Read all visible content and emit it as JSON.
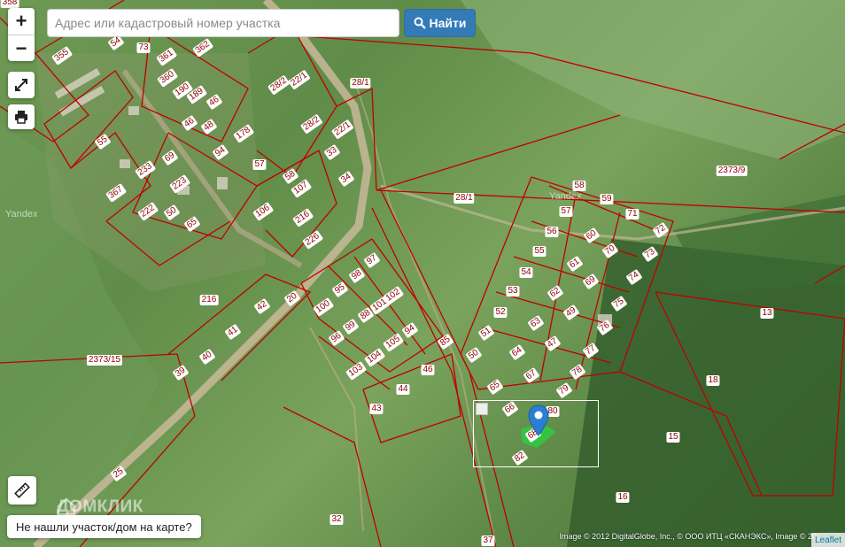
{
  "search": {
    "placeholder": "Адрес или кадастровый номер участка",
    "button_label": "Найти"
  },
  "controls": {
    "zoom_in": "+",
    "zoom_out": "−"
  },
  "help_button": "Не нашли участок/дом на карте?",
  "watermark": "ДОМКЛИК",
  "yandex_labels": [
    "Yandex",
    "Yandex"
  ],
  "attribution": "Image © 2012 DigitalGlobe, Inc., © ООО ИТЦ «СКАНЭКС», Image © 20",
  "leaflet": "Leaflet",
  "colors": {
    "parcel": "#c00000",
    "accent": "#337ab7",
    "marker": "#2a7fd4",
    "highlight": "#2ecc40"
  },
  "parcels": [
    {
      "id": "358"
    },
    {
      "id": "54"
    },
    {
      "id": "73"
    },
    {
      "id": "355"
    },
    {
      "id": "361"
    },
    {
      "id": "362"
    },
    {
      "id": "360"
    },
    {
      "id": "190"
    },
    {
      "id": "189"
    },
    {
      "id": "46"
    },
    {
      "id": "46"
    },
    {
      "id": "48"
    },
    {
      "id": "55"
    },
    {
      "id": "178"
    },
    {
      "id": "69"
    },
    {
      "id": "233"
    },
    {
      "id": "94"
    },
    {
      "id": "57"
    },
    {
      "id": "223"
    },
    {
      "id": "367"
    },
    {
      "id": "222"
    },
    {
      "id": "50"
    },
    {
      "id": "58"
    },
    {
      "id": "107"
    },
    {
      "id": "65"
    },
    {
      "id": "106"
    },
    {
      "id": "216"
    },
    {
      "id": "226"
    },
    {
      "id": "22/1"
    },
    {
      "id": "28/2"
    },
    {
      "id": "28/1"
    },
    {
      "id": "28/2"
    },
    {
      "id": "22/1"
    },
    {
      "id": "33"
    },
    {
      "id": "34"
    },
    {
      "id": "28/1"
    },
    {
      "id": "2373/9"
    },
    {
      "id": "58"
    },
    {
      "id": "59"
    },
    {
      "id": "71"
    },
    {
      "id": "57"
    },
    {
      "id": "72"
    },
    {
      "id": "56"
    },
    {
      "id": "60"
    },
    {
      "id": "70"
    },
    {
      "id": "73"
    },
    {
      "id": "55"
    },
    {
      "id": "61"
    },
    {
      "id": "54"
    },
    {
      "id": "69"
    },
    {
      "id": "74"
    },
    {
      "id": "53"
    },
    {
      "id": "62"
    },
    {
      "id": "75"
    },
    {
      "id": "52"
    },
    {
      "id": "49"
    },
    {
      "id": "63"
    },
    {
      "id": "76"
    },
    {
      "id": "51"
    },
    {
      "id": "47"
    },
    {
      "id": "64"
    },
    {
      "id": "77"
    },
    {
      "id": "50"
    },
    {
      "id": "67"
    },
    {
      "id": "78"
    },
    {
      "id": "65"
    },
    {
      "id": "79"
    },
    {
      "id": "66"
    },
    {
      "id": "80"
    },
    {
      "id": "68"
    },
    {
      "id": "82"
    },
    {
      "id": "13"
    },
    {
      "id": "18"
    },
    {
      "id": "15"
    },
    {
      "id": "16"
    },
    {
      "id": "97"
    },
    {
      "id": "98"
    },
    {
      "id": "95"
    },
    {
      "id": "102"
    },
    {
      "id": "100"
    },
    {
      "id": "101"
    },
    {
      "id": "88"
    },
    {
      "id": "99"
    },
    {
      "id": "96"
    },
    {
      "id": "94"
    },
    {
      "id": "105"
    },
    {
      "id": "104"
    },
    {
      "id": "103"
    },
    {
      "id": "46"
    },
    {
      "id": "44"
    },
    {
      "id": "43"
    },
    {
      "id": "85"
    },
    {
      "id": "216"
    },
    {
      "id": "42"
    },
    {
      "id": "20"
    },
    {
      "id": "41"
    },
    {
      "id": "40"
    },
    {
      "id": "39"
    },
    {
      "id": "2373/15"
    },
    {
      "id": "25"
    },
    {
      "id": "32"
    },
    {
      "id": "37"
    }
  ]
}
